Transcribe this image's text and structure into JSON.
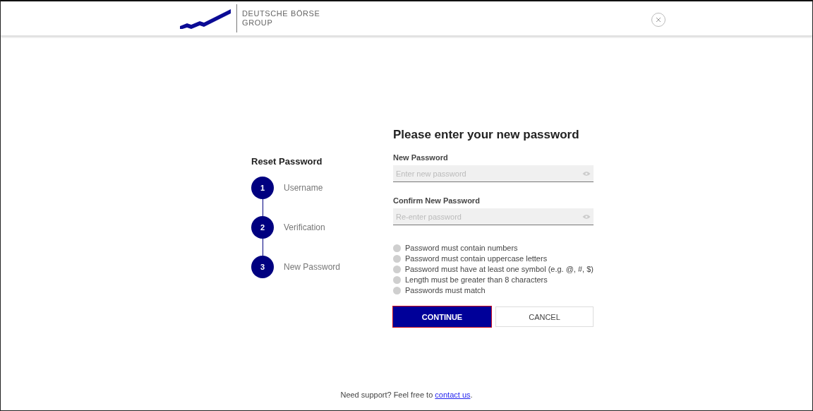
{
  "header": {
    "brand_line_1": "DEUTSCHE BÖRSE",
    "brand_line_2": "GROUP"
  },
  "steps_panel": {
    "title": "Reset Password",
    "steps": [
      {
        "number": "1",
        "label": "Username"
      },
      {
        "number": "2",
        "label": "Verification"
      },
      {
        "number": "3",
        "label": "New Password"
      }
    ]
  },
  "form": {
    "heading": "Please enter your new password",
    "fields": [
      {
        "label": "New Password",
        "placeholder": "Enter new password"
      },
      {
        "label": "Confirm New Password",
        "placeholder": "Re-enter password"
      }
    ],
    "requirements": [
      {
        "text": "Password must contain numbers",
        "met": false
      },
      {
        "text": "Password must contain uppercase letters",
        "met": false
      },
      {
        "text": "Password must have at least one symbol (e.g. @, #, $)",
        "met": false
      },
      {
        "text": "Length must be greater than 8 characters",
        "met": false
      },
      {
        "text": "Passwords must match",
        "met": false
      }
    ],
    "buttons": [
      {
        "label": "CONTINUE",
        "kind": "primary",
        "focused": true
      },
      {
        "label": "CANCEL",
        "kind": "secondary",
        "focused": false
      }
    ]
  },
  "footer": {
    "text": "Need support? Feel free to ",
    "link": "contact us",
    "end": "."
  }
}
